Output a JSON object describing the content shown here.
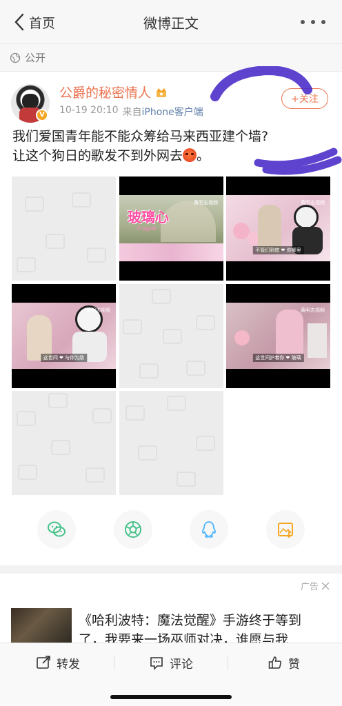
{
  "nav": {
    "back_label": "首页",
    "title": "微博正文"
  },
  "visibility": {
    "label": "公开"
  },
  "post": {
    "user": {
      "name": "公爵的秘密情人"
    },
    "time": "10-19 20:10",
    "source_prefix": "来自",
    "source": "iPhone客户端",
    "follow_label": "+关注",
    "text_line1": "我们爱国青年能不能众筹给马来西亚建个墙?",
    "text_line2": "让这个狗日的歌发不到外网去",
    "text_end": "。",
    "video_frames": {
      "frame1_title": "玻璃心",
      "frame1_sub": "Fragile",
      "frame1_wm": "黄明志视频",
      "frame2_wm": "黄明志视频",
      "frame2_sub": "不管们到底 ❤ 你哪里",
      "frame3_wm": "黄明志视频",
      "frame3_sub": "这世间 ❤ 与你为敌",
      "frame4_wm": "黄明志视频",
      "frame4_sub": "这世间护着你 ❤ 玻璃"
    }
  },
  "share": [
    "wechat-icon",
    "moments-icon",
    "qq-icon",
    "save-image-icon"
  ],
  "ad": {
    "tag": "广告",
    "line1": "《哈利波特：魔法觉醒》手游终于等到",
    "line2": "了，我要来一场巫师对决，谁愿与我"
  },
  "bottom": {
    "repost": "转发",
    "comment": "评论",
    "like": "赞"
  },
  "colors": {
    "accent": "#eb7350",
    "link": "#5d7da8",
    "scribble": "#4b2fc9"
  }
}
